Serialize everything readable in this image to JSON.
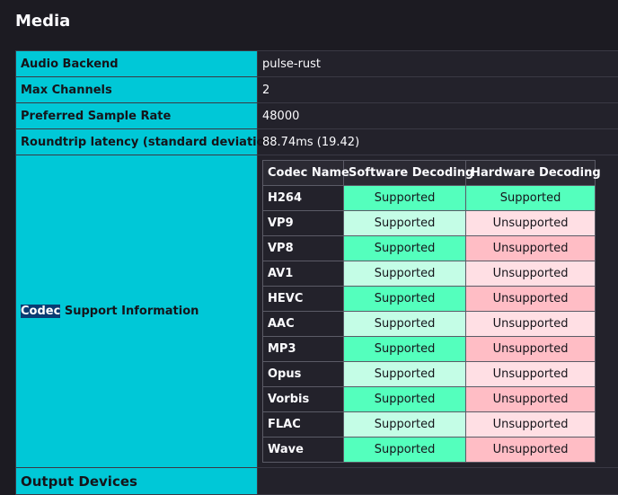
{
  "section": {
    "title": "Media"
  },
  "rows": {
    "audio_backend": {
      "label": "Audio Backend",
      "value": "pulse-rust"
    },
    "max_channels": {
      "label": "Max Channels",
      "value": "2"
    },
    "preferred_sample_rate": {
      "label": "Preferred Sample Rate",
      "value": "48000"
    },
    "roundtrip_latency": {
      "label": "Roundtrip latency (standard deviation)",
      "value": "88.74ms (19.42)"
    }
  },
  "codec_support": {
    "label_highlight": "Codec",
    "label_rest": " Support Information",
    "headers": {
      "name": "Codec Name",
      "software": "Software Decoding",
      "hardware": "Hardware Decoding"
    },
    "codecs": [
      {
        "name": "H264",
        "software": "Supported",
        "hardware": "Supported"
      },
      {
        "name": "VP9",
        "software": "Supported",
        "hardware": "Unsupported"
      },
      {
        "name": "VP8",
        "software": "Supported",
        "hardware": "Unsupported"
      },
      {
        "name": "AV1",
        "software": "Supported",
        "hardware": "Unsupported"
      },
      {
        "name": "HEVC",
        "software": "Supported",
        "hardware": "Unsupported"
      },
      {
        "name": "AAC",
        "software": "Supported",
        "hardware": "Unsupported"
      },
      {
        "name": "MP3",
        "software": "Supported",
        "hardware": "Unsupported"
      },
      {
        "name": "Opus",
        "software": "Supported",
        "hardware": "Unsupported"
      },
      {
        "name": "Vorbis",
        "software": "Supported",
        "hardware": "Unsupported"
      },
      {
        "name": "FLAC",
        "software": "Supported",
        "hardware": "Unsupported"
      },
      {
        "name": "Wave",
        "software": "Supported",
        "hardware": "Unsupported"
      }
    ]
  },
  "output_devices": {
    "label": "Output Devices"
  },
  "colors": {
    "header_bg": "#00c8d7",
    "supported_dark": "#54ffbd",
    "supported_light": "#c4fde6",
    "unsupported_dark": "#ffbdc5",
    "unsupported_light": "#ffdfe4"
  }
}
